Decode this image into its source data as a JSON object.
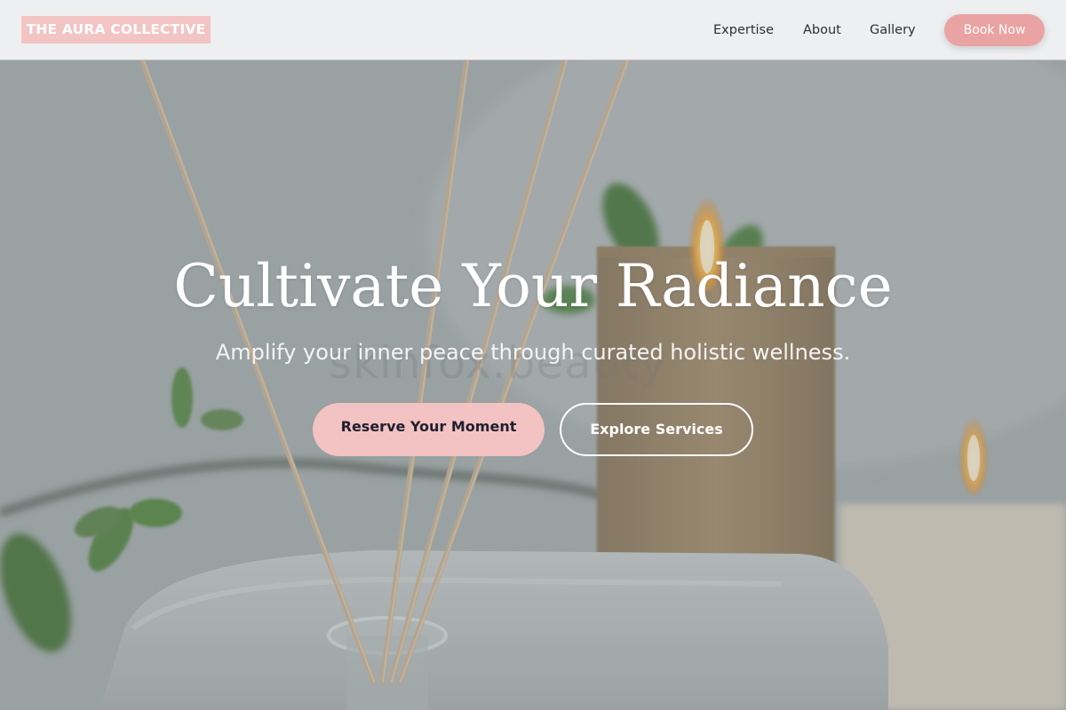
{
  "header": {
    "brand": "THE AURA COLLECTIVE",
    "nav": [
      "Expertise",
      "About",
      "Gallery"
    ],
    "cta": "Book Now"
  },
  "hero": {
    "headline": "Cultivate Your Radiance",
    "subheadline": "Amplify your inner peace through curated holistic wellness.",
    "primary_cta": "Reserve Your Moment",
    "secondary_cta": "Explore Services",
    "watermark": "skinfox.beauty"
  },
  "colors": {
    "brand_pink": "#f3c4c4",
    "book_button": "#eaa3a3",
    "primary_cta_bg": "#f3c2c3",
    "header_bg": "#eeeff0"
  }
}
